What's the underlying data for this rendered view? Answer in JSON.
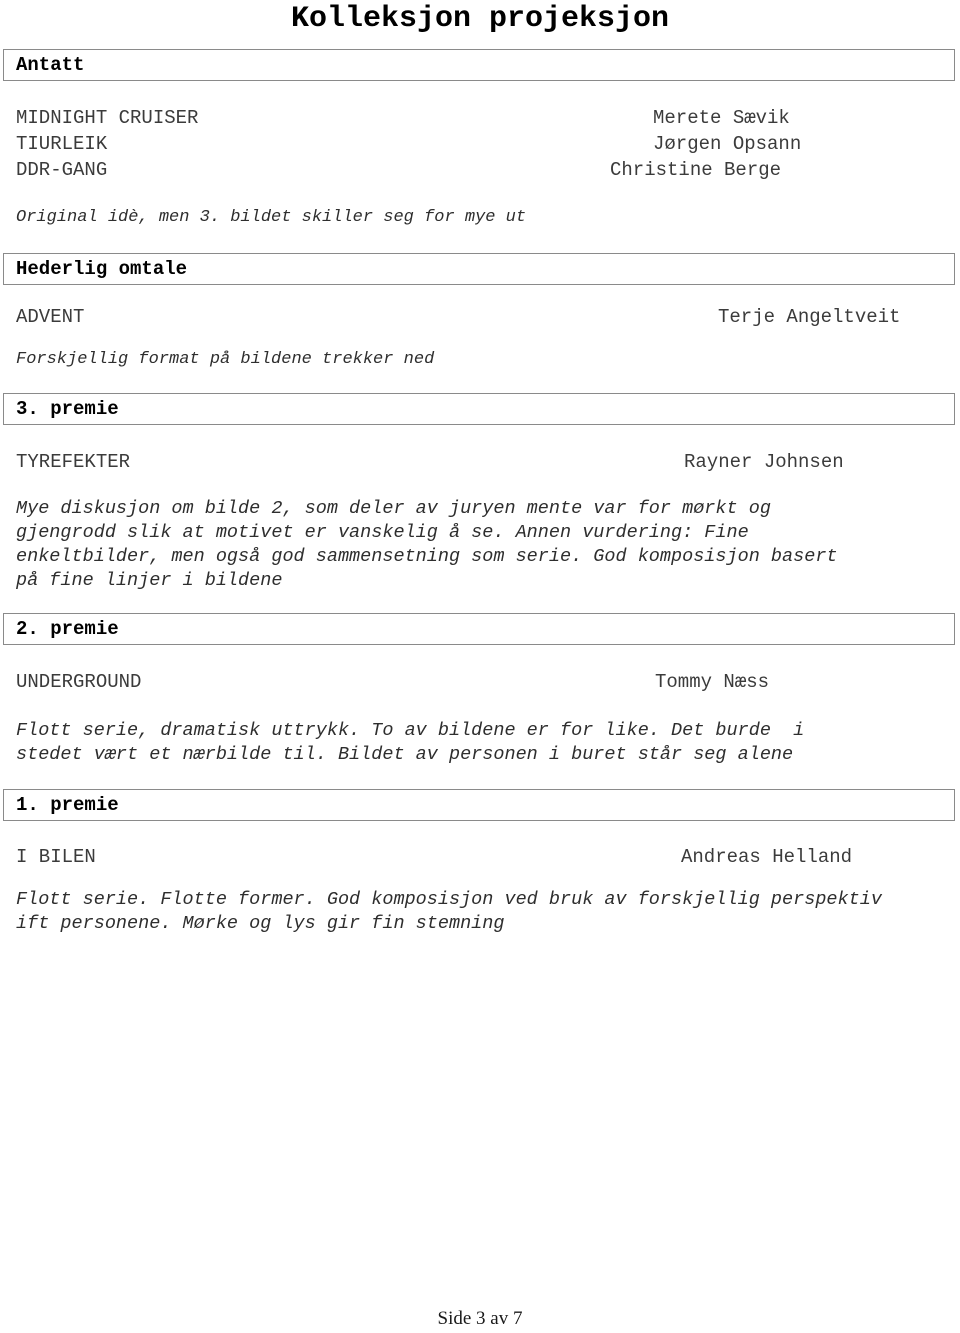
{
  "document": {
    "title": "Kolleksjon projeksjon",
    "footer": "Side 3 av 7"
  },
  "sections": [
    {
      "heading": "Antatt",
      "entries": [
        {
          "work": "MIDNIGHT CRUISER",
          "person": "Merete Sævik"
        },
        {
          "work": "TIURLEIK",
          "person": "Jørgen Opsann"
        },
        {
          "work": "DDR-GANG",
          "person": "Christine Berge"
        }
      ],
      "comment": "Original idè, men 3. bildet skiller seg for mye ut"
    },
    {
      "heading": "Hederlig omtale",
      "entries": [
        {
          "work": "ADVENT",
          "person": "Terje Angeltveit"
        }
      ],
      "comment": "Forskjellig format på bildene trekker ned"
    },
    {
      "heading": "3. premie",
      "entries": [
        {
          "work": "TYREFEKTER",
          "person": "Rayner Johnsen"
        }
      ],
      "comment": "Mye diskusjon om bilde 2, som deler av juryen mente var for mørkt og\ngjengrodd slik at motivet er vanskelig å se. Annen vurdering: Fine\nenkeltbilder, men også god sammensetning som serie. God komposisjon basert\npå fine linjer i bildene"
    },
    {
      "heading": "2. premie",
      "entries": [
        {
          "work": "UNDERGROUND",
          "person": "Tommy Næss"
        }
      ],
      "comment": "Flott serie, dramatisk uttrykk. To av bildene er for like. Det burde  i\nstedet vært et nærbilde til. Bildet av personen i buret står seg alene"
    },
    {
      "heading": "1. premie",
      "entries": [
        {
          "work": "I BILEN",
          "person": "Andreas Helland"
        }
      ],
      "comment": "Flott serie. Flotte former. God komposisjon ved bruk av forskjellig perspektiv\nift personene. Mørke og lys gir fin stemning"
    }
  ]
}
